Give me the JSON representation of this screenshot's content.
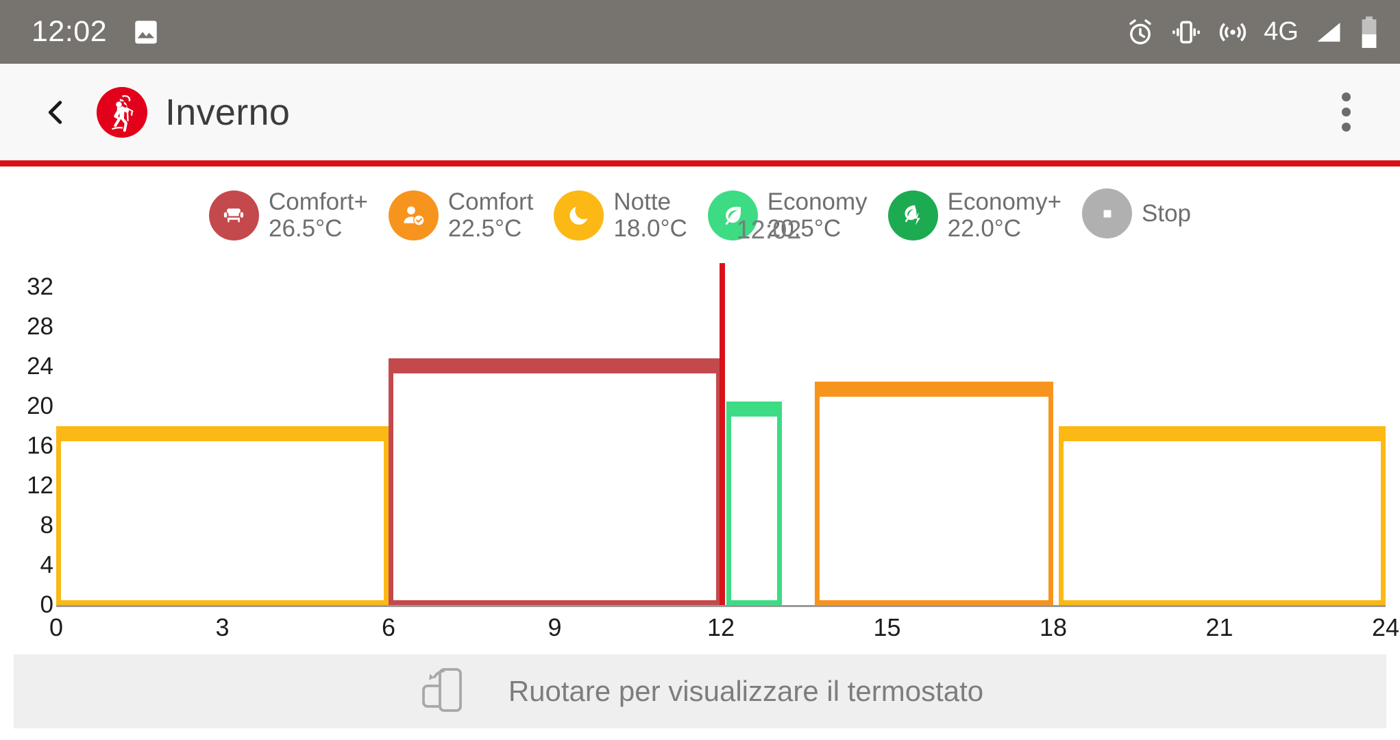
{
  "status_bar": {
    "time": "12:02",
    "network_label": "4G",
    "left_icons": [
      "image-icon"
    ],
    "right_icons": [
      "alarm-icon",
      "vibrate-icon",
      "hotspot-icon",
      "signal-icon",
      "battery-icon"
    ]
  },
  "app_bar": {
    "back_icon": "chevron-left-icon",
    "logo_icon": "brand-logo-icon",
    "title": "Inverno",
    "overflow_icon": "overflow-menu-icon",
    "accent_color": "#d8121a"
  },
  "legend": {
    "items": [
      {
        "name": "Comfort+",
        "temp": "26.5°C",
        "color": "#c4494c",
        "icon": "armchair-icon"
      },
      {
        "name": "Comfort",
        "temp": "22.5°C",
        "color": "#f7941e",
        "icon": "person-check-icon"
      },
      {
        "name": "Notte",
        "temp": "18.0°C",
        "color": "#fcb814",
        "icon": "moon-icon"
      },
      {
        "name": "Economy",
        "temp": "20.5°C",
        "color": "#3ddc84",
        "icon": "leaf-icon"
      },
      {
        "name": "Economy+",
        "temp": "22.0°C",
        "color": "#1dab51",
        "icon": "eco-bolt-icon"
      },
      {
        "name": "Stop",
        "temp": "",
        "color": "#b0b0b0",
        "icon": "stop-square-icon"
      }
    ]
  },
  "chart_data": {
    "type": "bar",
    "title": "",
    "xlabel": "",
    "ylabel": "",
    "xlim": [
      0,
      24
    ],
    "ylim": [
      0,
      34
    ],
    "x_ticks": [
      "0",
      "3",
      "6",
      "9",
      "12",
      "15",
      "18",
      "21",
      "24"
    ],
    "x_tick_values": [
      0,
      3,
      6,
      9,
      12,
      15,
      18,
      21,
      24
    ],
    "y_ticks": [
      "0",
      "4",
      "8",
      "12",
      "16",
      "20",
      "24",
      "28",
      "32"
    ],
    "y_tick_values": [
      0,
      4,
      8,
      12,
      16,
      20,
      24,
      28,
      32
    ],
    "grid": false,
    "legend_position": "top",
    "now_marker": {
      "label": "12:02",
      "x_value": 12.03,
      "color": "#d8121a"
    },
    "series": [
      {
        "name": "Notte",
        "start": 0.0,
        "end": 6.0,
        "value": 18.0,
        "color": "#fcb814"
      },
      {
        "name": "Comfort+",
        "start": 6.0,
        "end": 12.0,
        "value": 24.8,
        "color": "#c4494c"
      },
      {
        "name": "Economy",
        "start": 12.1,
        "end": 13.1,
        "value": 20.5,
        "color": "#3ddc84"
      },
      {
        "name": "Comfort",
        "start": 13.7,
        "end": 18.0,
        "value": 22.5,
        "color": "#f7941e"
      },
      {
        "name": "Notte",
        "start": 18.1,
        "end": 24.0,
        "value": 18.0,
        "color": "#fcb814"
      }
    ]
  },
  "footer": {
    "icon": "rotate-device-icon",
    "text": "Ruotare per visualizzare il termostato"
  }
}
